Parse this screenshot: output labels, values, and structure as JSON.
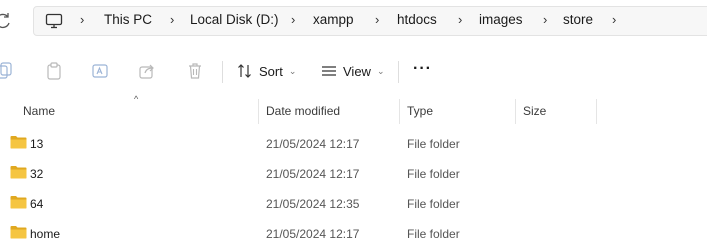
{
  "address_bar": {
    "crumbs": [
      "This PC",
      "Local Disk (D:)",
      "xampp",
      "htdocs",
      "images",
      "store"
    ]
  },
  "toolbar": {
    "sort_label": "Sort",
    "view_label": "View",
    "more_label": "···"
  },
  "columns": {
    "name": "Name",
    "date": "Date modified",
    "type": "Type",
    "size": "Size"
  },
  "rows": [
    {
      "name": "13",
      "date": "21/05/2024 12:17",
      "type": "File folder"
    },
    {
      "name": "32",
      "date": "21/05/2024 12:17",
      "type": "File folder"
    },
    {
      "name": "64",
      "date": "21/05/2024 12:35",
      "type": "File folder"
    },
    {
      "name": "home",
      "date": "21/05/2024 12:17",
      "type": "File folder"
    }
  ],
  "colors": {
    "folder": "#f5c542",
    "folder_dark": "#e0a820"
  }
}
